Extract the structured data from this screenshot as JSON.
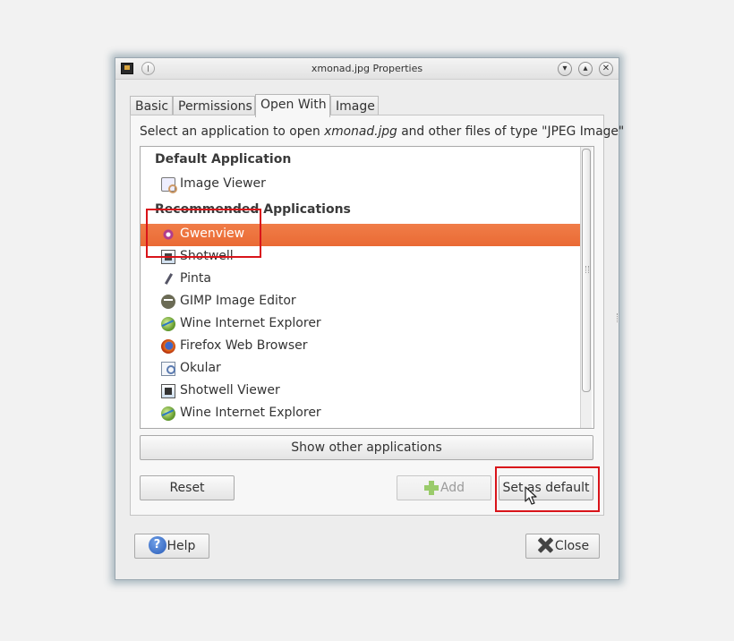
{
  "window": {
    "title": "xmonad.jpg Properties",
    "controls": {
      "minimize": "▾",
      "maximize": "▴",
      "close": "✕"
    }
  },
  "tabs": [
    {
      "label": "Basic"
    },
    {
      "label": "Permissions"
    },
    {
      "label": "Open With"
    },
    {
      "label": "Image"
    }
  ],
  "active_tab": "Open With",
  "open_with": {
    "description_prefix": "Select an application to open ",
    "description_file": "xmonad.jpg",
    "description_suffix": " and other files of type \"JPEG Image\"",
    "default_header": "Default Application",
    "default_app": {
      "label": "Image Viewer",
      "icon": "image-viewer-icon"
    },
    "recommended_header": "Recommended Applications",
    "recommended_apps": [
      {
        "label": "Gwenview",
        "icon": "gwenview-icon",
        "selected": true
      },
      {
        "label": "Shotwell",
        "icon": "shotwell-icon"
      },
      {
        "label": "Pinta",
        "icon": "pinta-icon"
      },
      {
        "label": "GIMP Image Editor",
        "icon": "gimp-icon"
      },
      {
        "label": "Wine Internet Explorer",
        "icon": "wine-icon"
      },
      {
        "label": "Firefox Web Browser",
        "icon": "firefox-icon"
      },
      {
        "label": "Okular",
        "icon": "okular-icon"
      },
      {
        "label": "Shotwell Viewer",
        "icon": "shotwell-viewer-icon"
      },
      {
        "label": "Wine Internet Explorer",
        "icon": "wine-icon"
      }
    ],
    "show_other_label": "Show other applications",
    "reset_label": "Reset",
    "add_label": "Add",
    "set_default_label": "Set as default"
  },
  "footer": {
    "help_label": "Help",
    "close_label": "Close"
  },
  "colors": {
    "selection": "#ec7038",
    "highlight_annotation": "#d9141a"
  }
}
